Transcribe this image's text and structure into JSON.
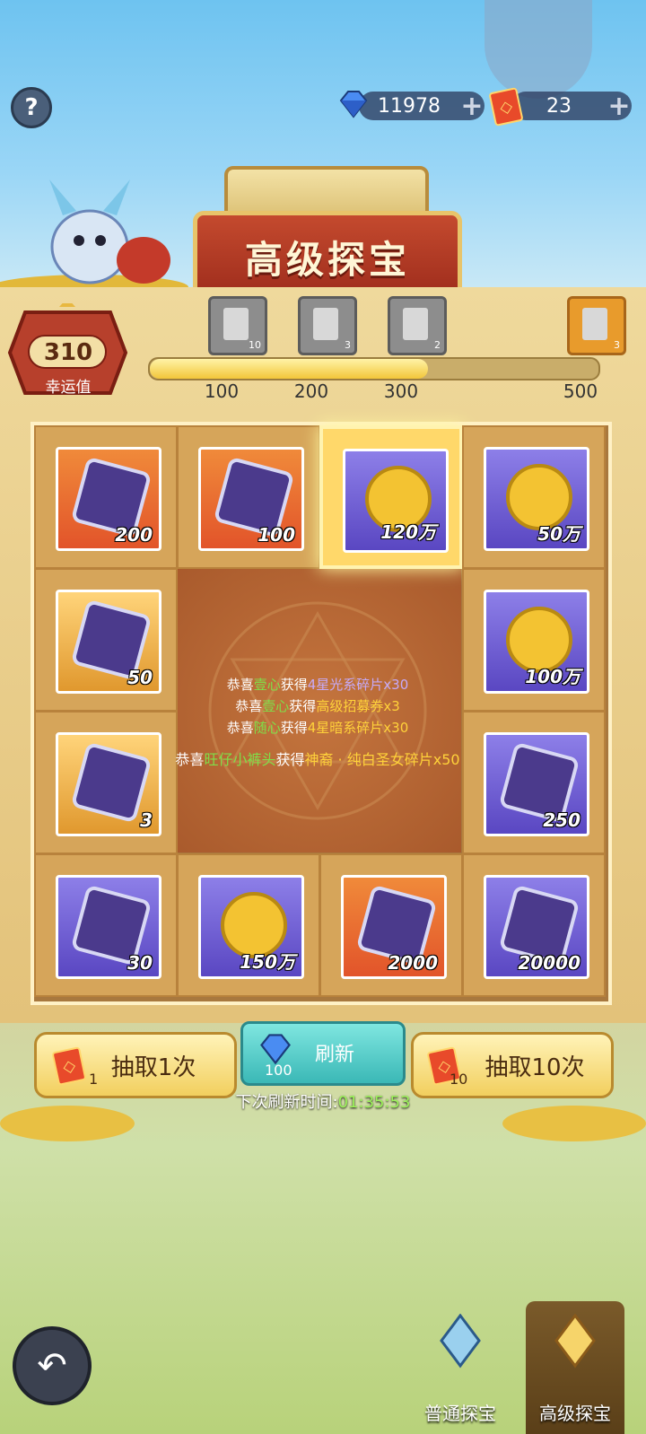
{
  "currencies": {
    "gems": "11978",
    "tickets": "23"
  },
  "banner_title": "高级探宝",
  "lucky": {
    "value": "310",
    "label": "幸运值"
  },
  "milestones": [
    {
      "label": "100",
      "count": "10",
      "icon": "card-icon"
    },
    {
      "label": "200",
      "count": "3",
      "icon": "scroll-icon"
    },
    {
      "label": "300",
      "count": "2",
      "icon": "armor-icon"
    },
    {
      "label": "500",
      "count": "3",
      "icon": "crystal-icon"
    }
  ],
  "progress_fraction": 0.62,
  "grid_items": [
    {
      "qty": "200",
      "style": "orange",
      "icon": "dark-gem-icon"
    },
    {
      "qty": "100",
      "style": "orange",
      "icon": "dark-gem-icon"
    },
    {
      "qty": "120万",
      "style": "purple",
      "icon": "gold-coin-icon",
      "selected": true
    },
    {
      "qty": "50万",
      "style": "purple",
      "icon": "gold-coin-icon"
    },
    {
      "qty": "50",
      "style": "gold",
      "icon": "hero-shard-icon"
    },
    {
      "qty": "100万",
      "style": "purple",
      "icon": "gold-coin-icon"
    },
    {
      "qty": "3",
      "style": "gold",
      "icon": "summon-scroll-icon"
    },
    {
      "qty": "250",
      "style": "purple",
      "icon": "blue-crystal-icon"
    },
    {
      "qty": "30",
      "style": "purple",
      "icon": "dark-hero-shard-icon"
    },
    {
      "qty": "150万",
      "style": "purple",
      "icon": "gold-coin-icon"
    },
    {
      "qty": "2000",
      "style": "orange",
      "icon": "ore-icon"
    },
    {
      "qty": "20000",
      "style": "purple",
      "icon": "exp-crystal-icon"
    }
  ],
  "messages": [
    {
      "prefix": "恭喜",
      "name": "壹心",
      "mid": "获得",
      "item": "4星光系碎片x30"
    },
    {
      "prefix": "恭喜",
      "name": "壹心",
      "mid": "获得",
      "item": "高级招募券x3"
    },
    {
      "prefix": "恭喜",
      "name": "随心",
      "mid": "获得",
      "item": "4星暗系碎片x30"
    },
    {
      "prefix": "恭喜",
      "name": "旺仔小裤头",
      "mid": "获得",
      "item": "神裔 · 纯白圣女碎片x50"
    }
  ],
  "buttons": {
    "draw_one": "抽取1次",
    "draw_one_cost": "1",
    "refresh": "刷新",
    "refresh_cost": "100",
    "draw_ten": "抽取10次",
    "draw_ten_cost": "10"
  },
  "timer": {
    "label": "下次刷新时间:",
    "value": "01:35:53"
  },
  "tabs": {
    "normal": "普通探宝",
    "advanced": "高级探宝"
  },
  "help_label": "?"
}
